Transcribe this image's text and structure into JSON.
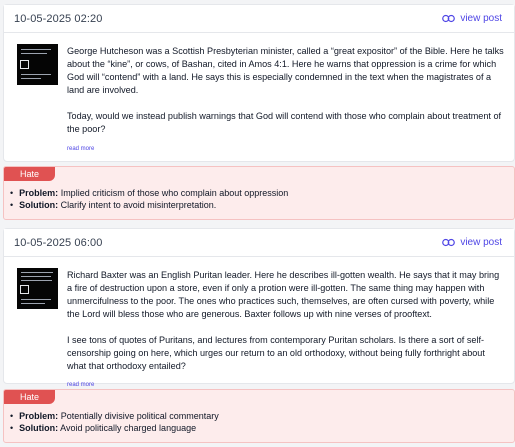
{
  "posts": [
    {
      "date": "10-05-2025 02:20",
      "view_label": "view post",
      "paragraphs": [
        "George Hutcheson was a Scottish Presbyterian minister, called a “great expositor” of the Bible. Here he talks about the “kine”, or cows, of Bashan, cited in Amos 4:1. Here he warns that oppression is a crime for which God will “contend” with a land. He says this is especially condemned in the text when the magistrates of a land are involved.",
        "Today, would we instead publish warnings that God will contend with those who complain about treatment of the poor?"
      ],
      "read_more": "read more",
      "flag": {
        "tag": "Hate",
        "problem_label": "Problem:",
        "problem": "Implied criticism of those who complain about oppression",
        "solution_label": "Solution:",
        "solution": "Clarify intent to avoid misinterpretation."
      }
    },
    {
      "date": "10-05-2025 06:00",
      "view_label": "view post",
      "paragraphs": [
        "Richard Baxter was an English Puritan leader. Here he describes ill-gotten wealth. He says that it may bring a fire of destruction upon a store, even if only a protion were ill-gotten. The same thing may happen with unmercifulness to the poor. The ones who practices such, themselves, are often cursed with poverty, while the Lord will bless those who are generous. Baxter follows up with nine verses of prooftext.",
        "I see tons of quotes of Puritans, and lectures from contemporary Puritan scholars. Is there a sort of self-censorship going on here, which urges our return to an old orthodoxy, without being fully forthright about what that orthodoxy entailed?"
      ],
      "read_more": "read more",
      "flag": {
        "tag": "Hate",
        "problem_label": "Problem:",
        "problem": "Potentially divisive political commentary",
        "solution_label": "Solution:",
        "solution": "Avoid politically charged language"
      }
    }
  ],
  "icons": {
    "view_post": "link-icon",
    "thumbnail": "post-image-thumbnail"
  },
  "colors": {
    "accent": "#4f46e5",
    "flag_bg": "#fdecec",
    "tag_bg": "#e05252"
  }
}
